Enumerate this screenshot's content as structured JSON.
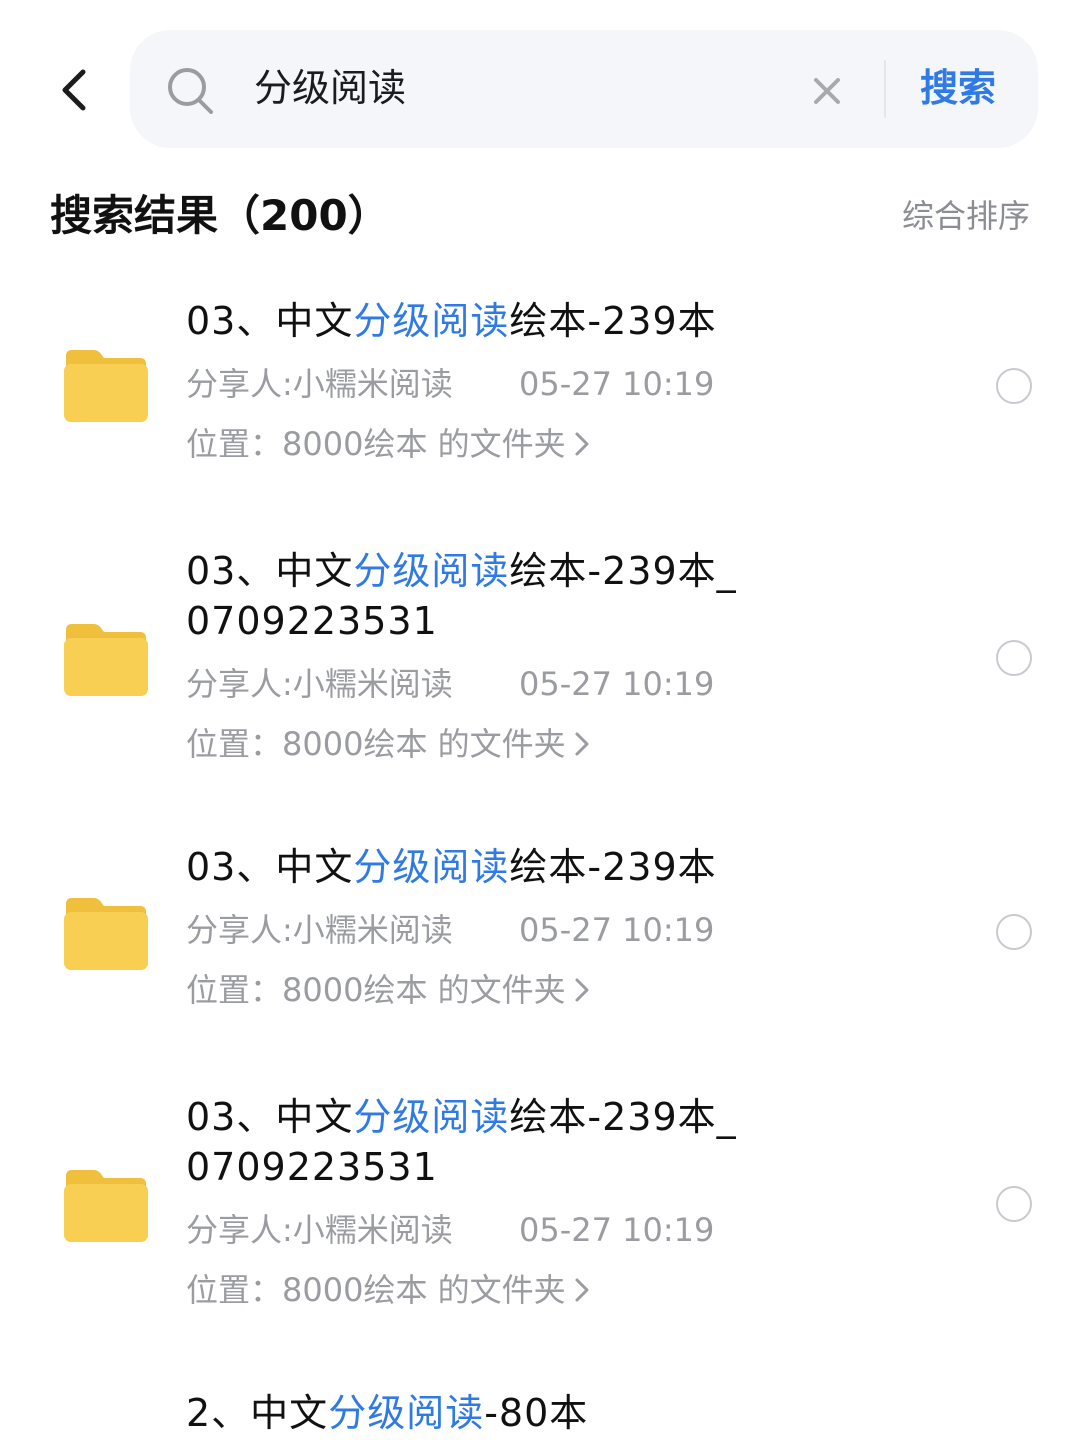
{
  "search": {
    "query": "分级阅读",
    "submit_label": "搜索"
  },
  "results": {
    "title": "搜索结果（200）",
    "sort_label": "综合排序"
  },
  "items": [
    {
      "title_prefix": "03、中文",
      "title_highlight": "分级阅读",
      "title_suffix": "绘本-239本",
      "sharer": "分享人:小糯米阅读",
      "time": "05-27 10:19",
      "location": "位置：8000绘本 的文件夹"
    },
    {
      "title_prefix": "03、中文",
      "title_highlight": "分级阅读",
      "title_suffix": "绘本-239本_0709223531",
      "sharer": "分享人:小糯米阅读",
      "time": "05-27 10:19",
      "location": "位置：8000绘本 的文件夹"
    },
    {
      "title_prefix": "03、中文",
      "title_highlight": "分级阅读",
      "title_suffix": "绘本-239本",
      "sharer": "分享人:小糯米阅读",
      "time": "05-27 10:19",
      "location": "位置：8000绘本 的文件夹"
    },
    {
      "title_prefix": "03、中文",
      "title_highlight": "分级阅读",
      "title_suffix": "绘本-239本_0709223531",
      "sharer": "分享人:小糯米阅读",
      "time": "05-27 10:19",
      "location": "位置：8000绘本 的文件夹"
    },
    {
      "title_prefix": "2、中文",
      "title_highlight": "分级阅读",
      "title_suffix": "-80本"
    }
  ],
  "colors": {
    "accent": "#2f7ae5",
    "folder": "#f8cf52",
    "muted_text": "#9a9ca1"
  }
}
